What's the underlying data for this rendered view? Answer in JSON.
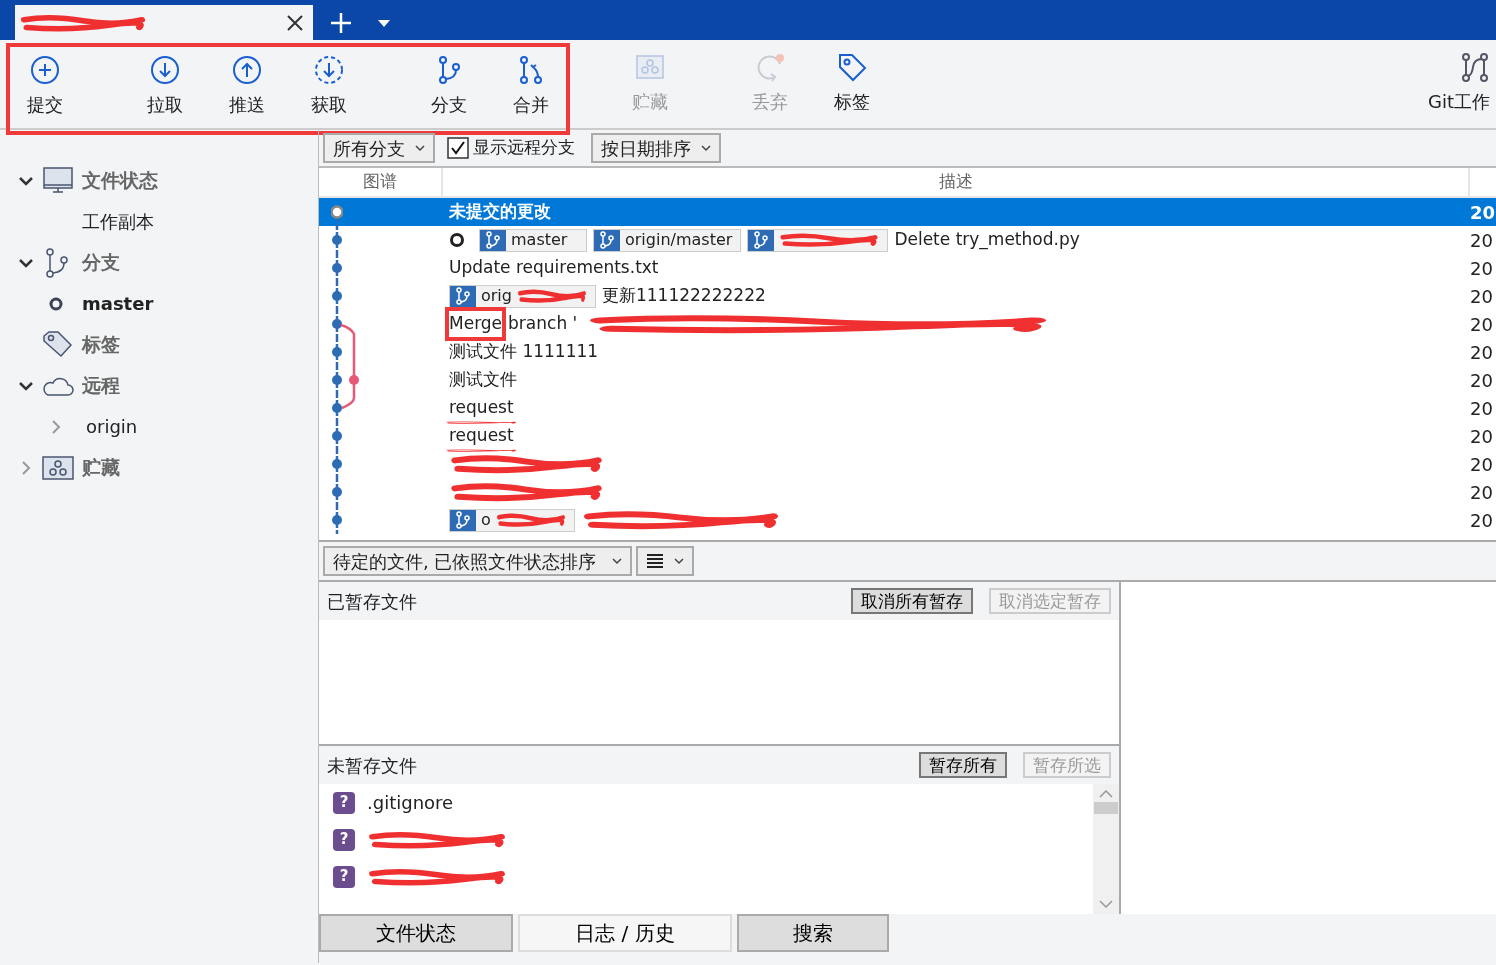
{
  "tabs": [
    {
      "redacted": true,
      "selected": true
    }
  ],
  "toolbar": {
    "groups": [
      {
        "highlighted": true,
        "buttons": [
          {
            "label": "提交",
            "kind": "plus",
            "disabled": false
          },
          {
            "label": "拉取",
            "kind": "down",
            "disabled": false
          },
          {
            "label": "推送",
            "kind": "up",
            "disabled": false
          },
          {
            "label": "获取",
            "kind": "fetch",
            "disabled": false
          },
          {
            "label": "分支",
            "kind": "branch",
            "disabled": false
          },
          {
            "label": "合并",
            "kind": "merge",
            "disabled": false
          }
        ]
      },
      {
        "highlighted": false,
        "buttons": [
          {
            "label": "贮藏",
            "kind": "stash",
            "disabled": true
          },
          {
            "label": "丢弃",
            "kind": "discard",
            "disabled": true
          },
          {
            "label": "标签",
            "kind": "tag",
            "disabled": false
          }
        ]
      },
      {
        "highlighted": false,
        "buttons": [
          {
            "label": "Git工作",
            "kind": "flow",
            "disabled": false
          }
        ]
      }
    ]
  },
  "sidebar": [
    {
      "label": "文件状态",
      "kind": "monitor",
      "expanded": true,
      "children": [
        {
          "label": "工作副本"
        }
      ]
    },
    {
      "label": "分支",
      "kind": "branch",
      "expanded": true,
      "children": [
        {
          "label": "master",
          "current": true
        }
      ]
    },
    {
      "label": "标签",
      "kind": "tag"
    },
    {
      "label": "远程",
      "kind": "cloud",
      "expanded": true,
      "children": [
        {
          "label": "origin",
          "expanded": false
        }
      ]
    },
    {
      "label": "贮藏",
      "kind": "stash",
      "expanded": false
    }
  ],
  "filters": {
    "branch_filter": "所有分支",
    "show_remote": {
      "label": "显示远程分支",
      "checked": true
    },
    "sort": "按日期排序"
  },
  "log": {
    "columns": [
      "图谱",
      "描述"
    ],
    "commits": [
      {
        "kind": "uncommitted",
        "description": "未提交的更改",
        "date": "20",
        "selected": true
      },
      {
        "kind": "commit",
        "head": true,
        "refs": [
          {
            "label": "master"
          },
          {
            "label": "origin/master"
          },
          {
            "redacted": true
          }
        ],
        "description": "Delete try_method.py",
        "date": "20",
        "selected": false
      },
      {
        "kind": "commit",
        "description": "Update requirements.txt",
        "date": "20",
        "selected": false
      },
      {
        "kind": "commit",
        "refs": [
          {
            "label": "orig",
            "redacted": true
          }
        ],
        "description": "更新111122222222",
        "date": "20",
        "selected": false
      },
      {
        "kind": "merge",
        "description_parts": [
          {
            "text": "Merge",
            "highlighted": true
          },
          {
            "text": "branch '",
            "highlighted": false
          }
        ],
        "redacted": true,
        "date": "20",
        "selected": false
      },
      {
        "kind": "side_through",
        "description": "测试文件 1111111",
        "date": "20",
        "selected": false
      },
      {
        "kind": "side_node",
        "description": "测试文件",
        "date": "20",
        "selected": false
      },
      {
        "kind": "side_end",
        "description": "request",
        "redacted": true,
        "date": "20",
        "selected": false
      },
      {
        "kind": "commit",
        "description": "request",
        "redacted": true,
        "date": "20",
        "selected": false
      },
      {
        "kind": "commit",
        "redacted": true,
        "date": "20",
        "selected": false
      },
      {
        "kind": "commit",
        "redacted": true,
        "date": "20",
        "selected": false
      },
      {
        "kind": "commit",
        "refs": [
          {
            "label": "o",
            "redacted": true
          }
        ],
        "redacted": true,
        "date": "20",
        "selected": false
      }
    ]
  },
  "pending": {
    "sort": "待定的文件, 已依照文件状态排序",
    "staged": {
      "title": "已暂存文件",
      "buttons": [
        {
          "label": "取消所有暂存",
          "disabled": false
        },
        {
          "label": "取消选定暂存",
          "disabled": true
        }
      ]
    },
    "unstaged": {
      "title": "未暂存文件",
      "buttons": [
        {
          "label": "暂存所有",
          "disabled": false
        },
        {
          "label": "暂存所选",
          "disabled": true
        }
      ],
      "files": [
        {
          "status": "?",
          "name": ".gitignore"
        },
        {
          "status": "?",
          "redacted": true
        },
        {
          "status": "?",
          "redacted": true
        }
      ]
    }
  },
  "bottom_tabs": [
    {
      "label": "文件状态",
      "selected": false
    },
    {
      "label": "日志 / 历史",
      "selected": true
    },
    {
      "label": "搜索",
      "selected": false
    }
  ]
}
